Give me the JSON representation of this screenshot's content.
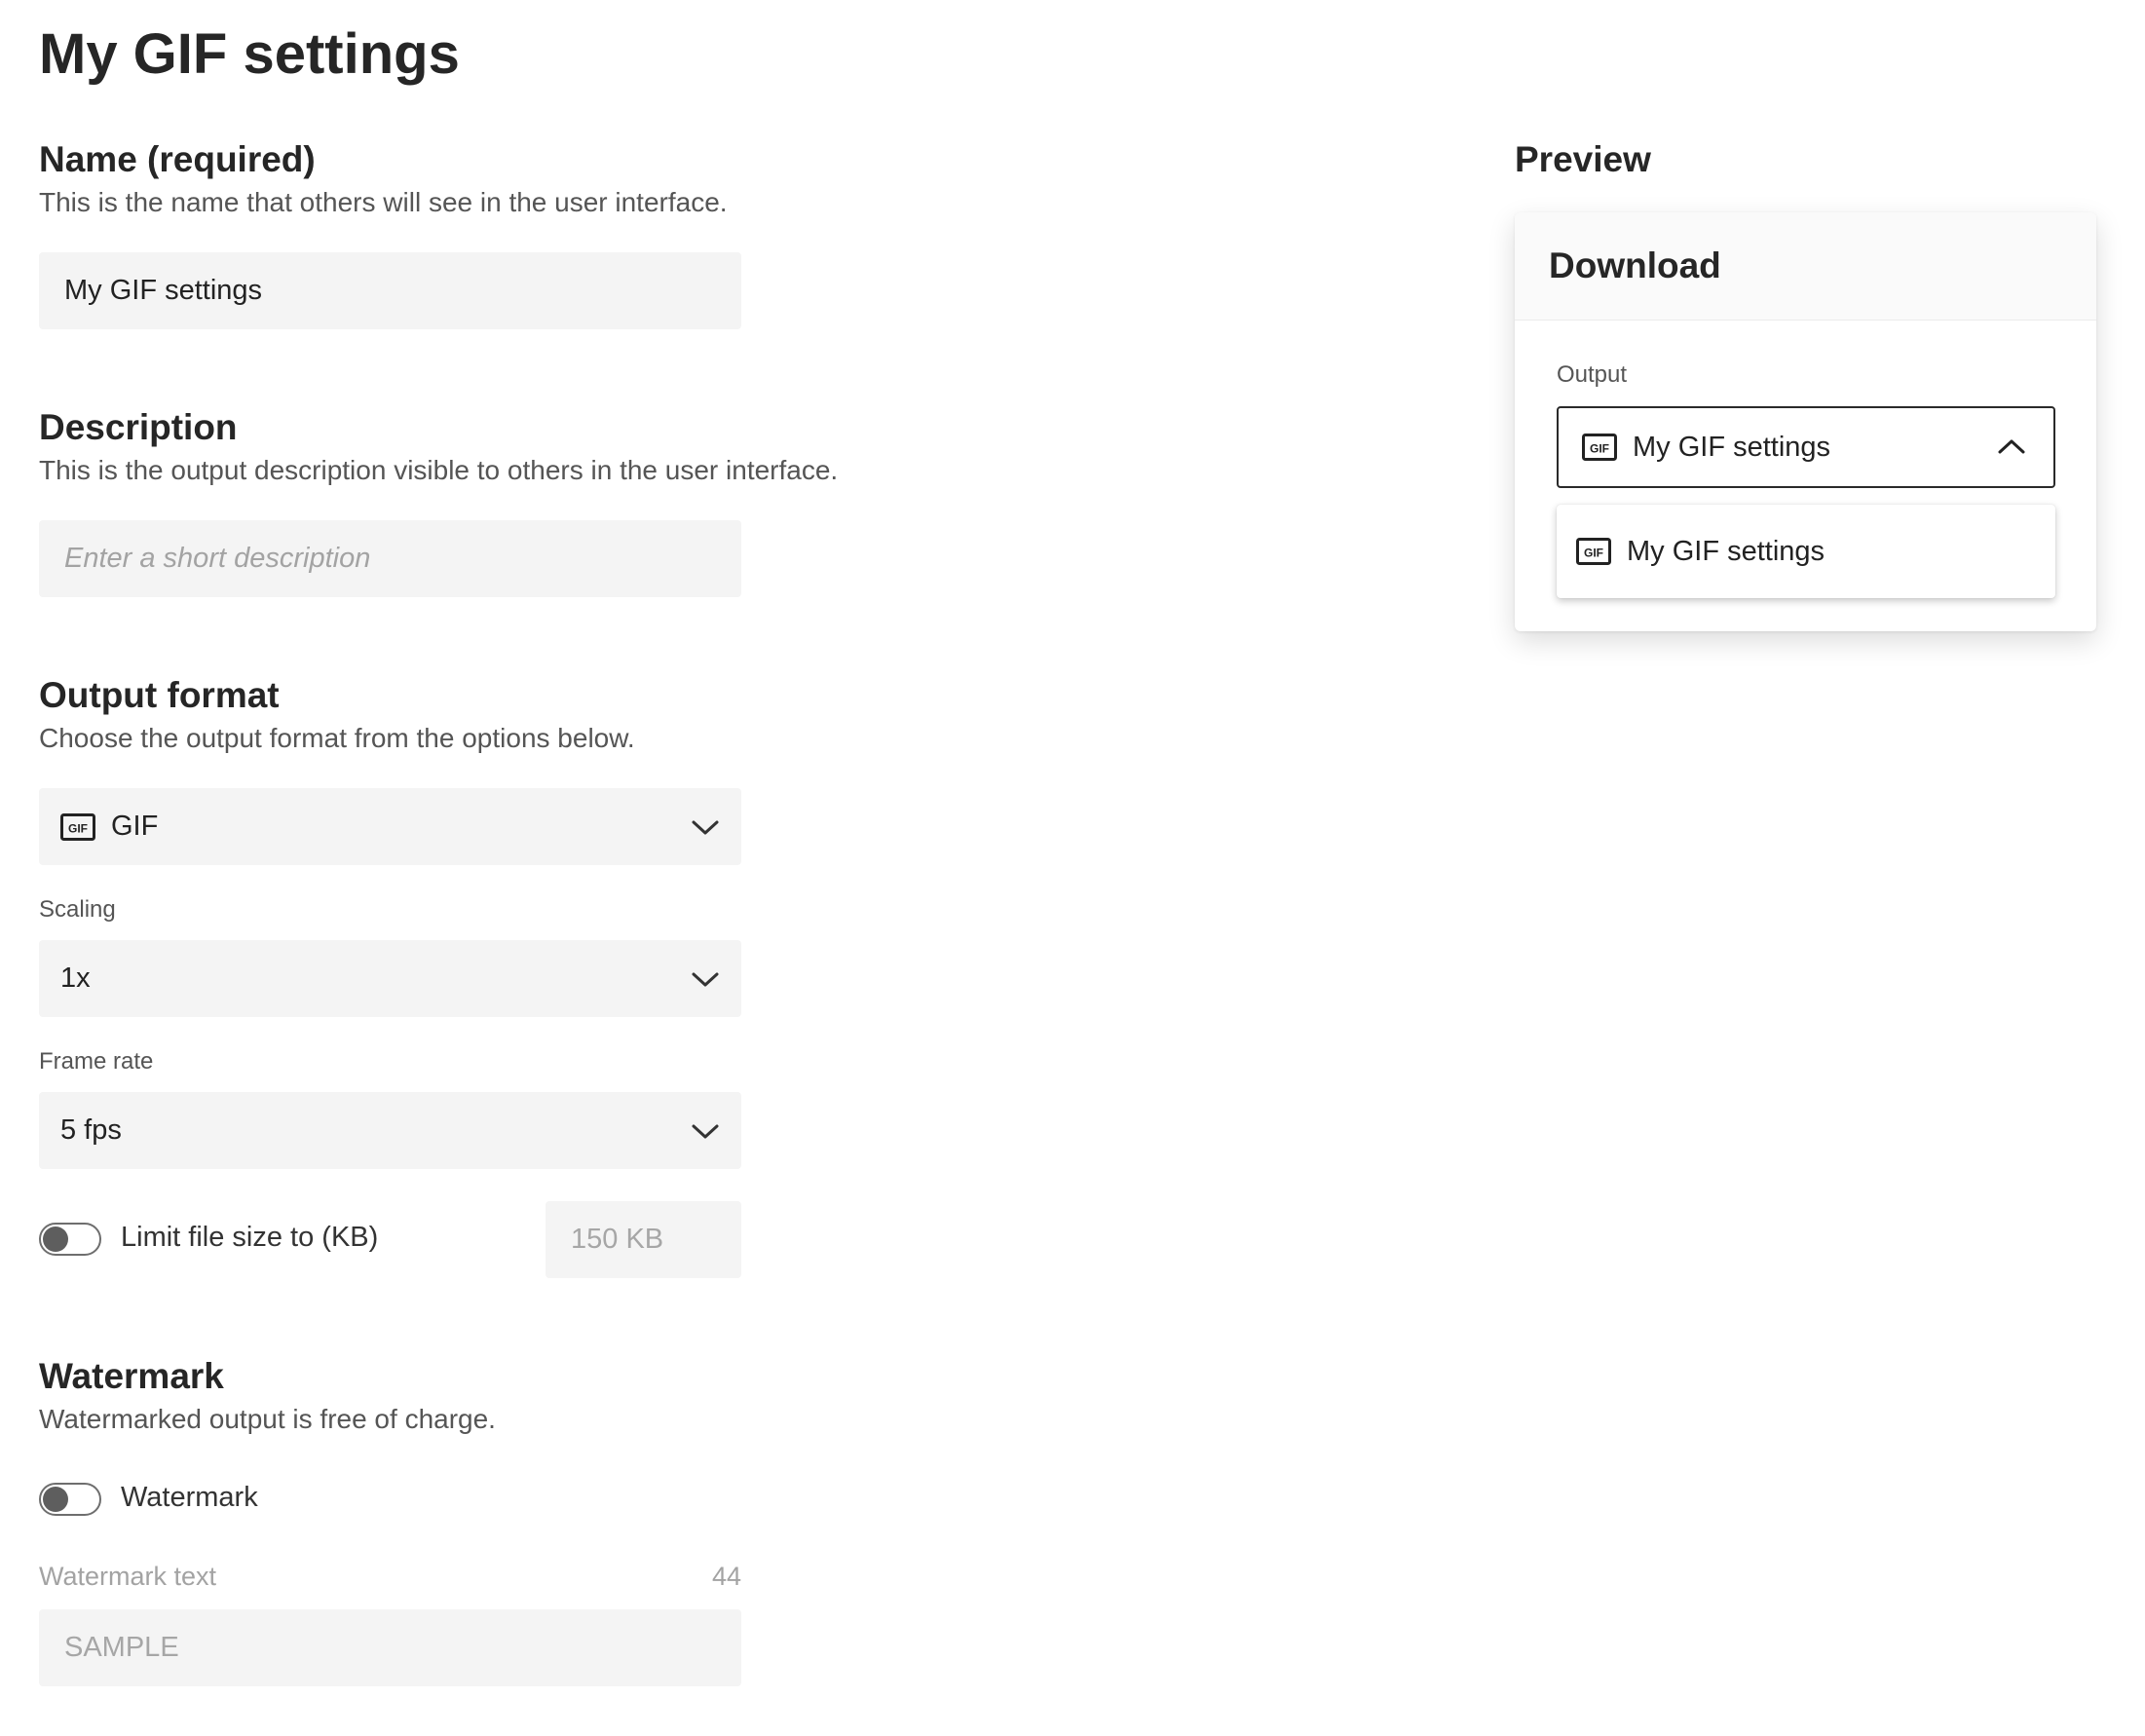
{
  "page": {
    "title": "My GIF settings"
  },
  "name_section": {
    "title": "Name (required)",
    "description": "This is the name that others will see in the user interface.",
    "value": "My GIF settings"
  },
  "description_section": {
    "title": "Description",
    "description": "This is the output description visible to others in the user interface.",
    "placeholder": "Enter a short description",
    "value": ""
  },
  "output_format_section": {
    "title": "Output format",
    "description": "Choose the output format from the options below.",
    "format_value": "GIF",
    "format_icon": "gif-icon",
    "scaling_label": "Scaling",
    "scaling_value": "1x",
    "frame_rate_label": "Frame rate",
    "frame_rate_value": "5 fps",
    "limit_toggle_label": "Limit file size to (KB)",
    "limit_toggle_on": false,
    "limit_value": "150 KB"
  },
  "watermark_section": {
    "title": "Watermark",
    "description": "Watermarked output is free of charge.",
    "toggle_label": "Watermark",
    "toggle_on": false,
    "text_label": "Watermark text",
    "char_count": "44",
    "text_value": "SAMPLE"
  },
  "preview": {
    "title": "Preview",
    "card_title": "Download",
    "output_label": "Output",
    "selected_output": "My GIF settings",
    "dropdown_open": true,
    "options": [
      "My GIF settings"
    ]
  },
  "icons": {
    "format": "gif-icon",
    "collapsed": "chevron-down-icon",
    "expanded": "chevron-up-icon"
  }
}
